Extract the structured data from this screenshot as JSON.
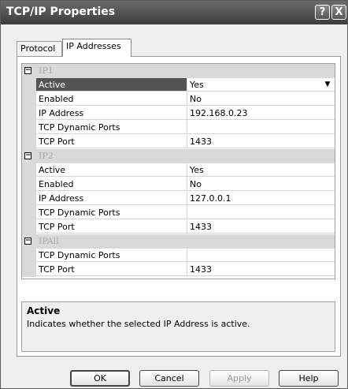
{
  "window": {
    "title": "TCP/IP Properties"
  },
  "titlebar_buttons": {
    "help": "?",
    "close": "X"
  },
  "tabs": [
    {
      "label": "Protocol"
    },
    {
      "label": "IP Addresses"
    }
  ],
  "grid": {
    "groups": [
      {
        "label": "IP1",
        "rows": [
          {
            "name": "Active",
            "value": "Yes"
          },
          {
            "name": "Enabled",
            "value": "No"
          },
          {
            "name": "IP Address",
            "value": "192.168.0.23"
          },
          {
            "name": "TCP Dynamic Ports",
            "value": ""
          },
          {
            "name": "TCP Port",
            "value": "1433"
          }
        ]
      },
      {
        "label": "IP2",
        "rows": [
          {
            "name": "Active",
            "value": "Yes"
          },
          {
            "name": "Enabled",
            "value": "No"
          },
          {
            "name": "IP Address",
            "value": "127.0.0.1"
          },
          {
            "name": "TCP Dynamic Ports",
            "value": ""
          },
          {
            "name": "TCP Port",
            "value": "1433"
          }
        ]
      },
      {
        "label": "IPAll",
        "rows": [
          {
            "name": "TCP Dynamic Ports",
            "value": ""
          },
          {
            "name": "TCP Port",
            "value": "1433"
          }
        ]
      }
    ],
    "expander_symbol": "−",
    "dropdown_arrow": "▼"
  },
  "description": {
    "title": "Active",
    "text": "Indicates whether the selected IP Address is active."
  },
  "buttons": {
    "ok": "OK",
    "cancel": "Cancel",
    "apply": "Apply",
    "help": "Help"
  }
}
